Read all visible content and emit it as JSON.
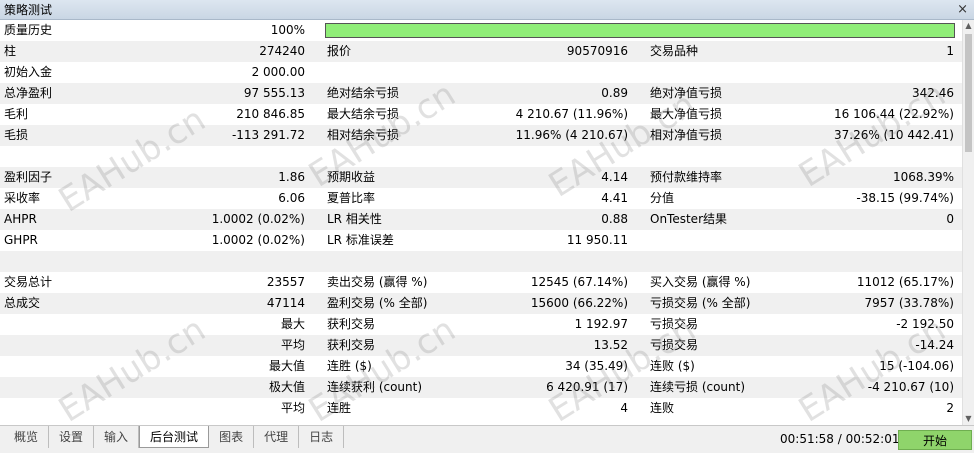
{
  "window": {
    "title": "策略测试",
    "close_glyph": "×"
  },
  "rows": {
    "quality": {
      "label": "质量历史",
      "value": "100%"
    },
    "bars": {
      "l1": "柱",
      "v1": "274240",
      "l2": "报价",
      "v2": "90570916",
      "l3": "交易品种",
      "v3": "1"
    },
    "deposit": {
      "l1": "初始入金",
      "v1": "2 000.00"
    },
    "profit": {
      "l1": "总净盈利",
      "v1": "97 555.13",
      "l2": "绝对结余亏损",
      "v2": "0.89",
      "l3": "绝对净值亏损",
      "v3": "342.46"
    },
    "gross_profit": {
      "l1": "毛利",
      "v1": "210 846.85",
      "l2": "最大结余亏损",
      "v2": "4 210.67 (11.96%)",
      "l3": "最大净值亏损",
      "v3": "16 106.44 (22.92%)"
    },
    "gross_loss": {
      "l1": "毛损",
      "v1": "-113 291.72",
      "l2": "相对结余亏损",
      "v2": "11.96% (4 210.67)",
      "l3": "相对净值亏损",
      "v3": "37.26% (10 442.41)"
    },
    "profit_factor": {
      "l1": "盈利因子",
      "v1": "1.86",
      "l2": "预期收益",
      "v2": "4.14",
      "l3": "预付款维持率",
      "v3": "1068.39%"
    },
    "recovery": {
      "l1": "采收率",
      "v1": "6.06",
      "l2": "夏普比率",
      "v2": "4.41",
      "l3": "分值",
      "v3": "-38.15 (99.74%)"
    },
    "ahpr": {
      "l1": "AHPR",
      "v1": "1.0002 (0.02%)",
      "l2": "LR 相关性",
      "v2": "0.88",
      "l3": "OnTester结果",
      "v3": "0"
    },
    "ghpr": {
      "l1": "GHPR",
      "v1": "1.0002 (0.02%)",
      "l2": "LR 标准误差",
      "v2": "11 950.11"
    },
    "trades": {
      "l1": "交易总计",
      "v1": "23557",
      "l2": "卖出交易 (赢得 %)",
      "v2": "12545 (67.14%)",
      "l3": "买入交易 (赢得 %)",
      "v3": "11012 (65.17%)"
    },
    "deals": {
      "l1": "总成交",
      "v1": "47114",
      "l2": "盈利交易 (% 全部)",
      "v2": "15600 (66.22%)",
      "l3": "亏损交易 (% 全部)",
      "v3": "7957 (33.78%)"
    },
    "largest": {
      "v1": "最大",
      "l2": "获利交易",
      "v2": "1 192.97",
      "l3": "亏损交易",
      "v3": "-2 192.50"
    },
    "average": {
      "v1": "平均",
      "l2": "获利交易",
      "v2": "13.52",
      "l3": "亏损交易",
      "v3": "-14.24"
    },
    "maximum": {
      "v1": "最大值",
      "l2": "连胜 ($)",
      "v2": "34 (35.49)",
      "l3": "连败 ($)",
      "v3": "15 (-104.06)"
    },
    "maximal": {
      "v1": "极大值",
      "l2": "连续获利 (count)",
      "v2": "6 420.91 (17)",
      "l3": "连续亏损 (count)",
      "v3": "-4 210.67 (10)"
    },
    "avg_consec": {
      "v1": "平均",
      "l2": "连胜",
      "v2": "4",
      "l3": "连败",
      "v3": "2"
    }
  },
  "tabs": [
    "概览",
    "设置",
    "输入",
    "后台测试",
    "图表",
    "代理",
    "日志"
  ],
  "active_tab": "后台测试",
  "timer": "00:51:58 / 00:52:01",
  "start_label": "开始",
  "watermark": "EAHub.cn",
  "colors": {
    "quality_bar": "#90ee78",
    "start_button": "#8fd46b",
    "row_shade": "#f0f0f0"
  }
}
